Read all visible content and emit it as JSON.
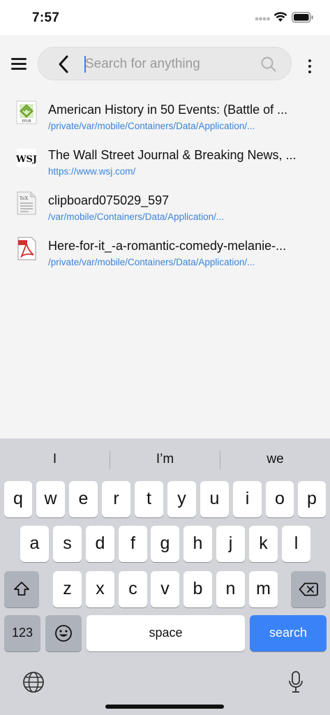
{
  "status_bar": {
    "time": "7:57"
  },
  "search": {
    "placeholder": "Search for anything",
    "value": ""
  },
  "results": [
    {
      "icon": "epub-file-icon",
      "title": "American History in 50 Events: (Battle of ...",
      "path": "/private/var/mobile/Containers/Data/Application/..."
    },
    {
      "icon": "wsj-site-icon",
      "title": "The Wall Street Journal & Breaking News, ...",
      "path": "https://www.wsj.com/"
    },
    {
      "icon": "tex-file-icon",
      "title": "clipboard075029_597",
      "path": "/var/mobile/Containers/Data/Application/..."
    },
    {
      "icon": "pdf-file-icon",
      "title": "Here-for-it_-a-romantic-comedy-melanie-...",
      "path": "/private/var/mobile/Containers/Data/Application/..."
    }
  ],
  "result_icon_labels": {
    "epub": "EPUB",
    "wsj": "WSJ",
    "tex": "TeX"
  },
  "keyboard": {
    "suggestions": [
      "I",
      "I’m",
      "we"
    ],
    "row1": [
      "q",
      "w",
      "e",
      "r",
      "t",
      "y",
      "u",
      "i",
      "o",
      "p"
    ],
    "row2": [
      "a",
      "s",
      "d",
      "f",
      "g",
      "h",
      "j",
      "k",
      "l"
    ],
    "row3": [
      "z",
      "x",
      "c",
      "v",
      "b",
      "n",
      "m"
    ],
    "numbers_label": "123",
    "space_label": "space",
    "action_label": "search"
  },
  "colors": {
    "accent": "#3a82f7",
    "link": "#3b84d8"
  }
}
